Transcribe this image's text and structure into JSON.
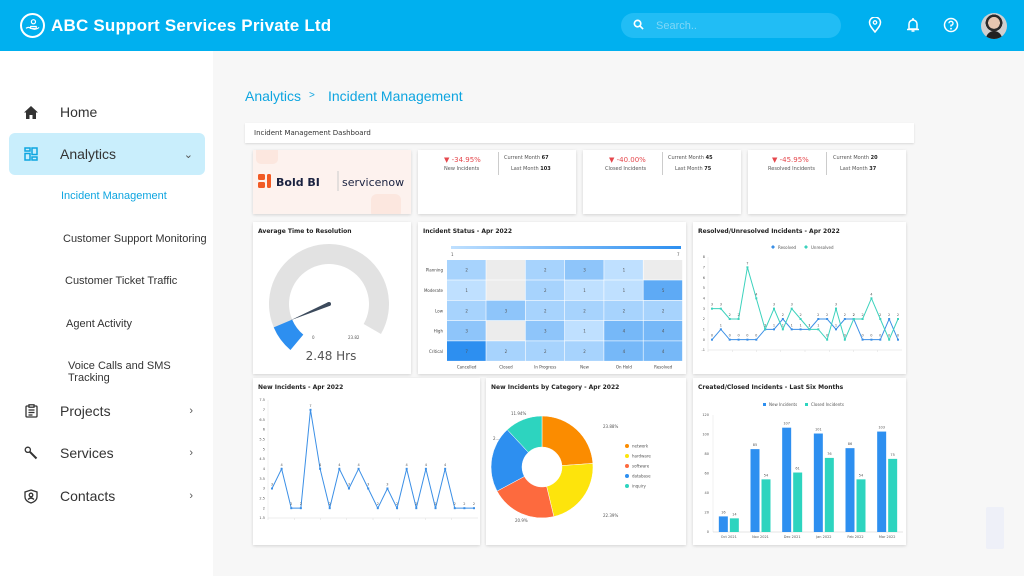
{
  "header": {
    "title": "ABC Support Services Private Ltd",
    "logo_icon": "hand-holding-person-icon",
    "search_placeholder": "Search..",
    "icons": [
      "location-pin-icon",
      "bell-icon",
      "help-circle-icon"
    ],
    "avatar": "user-avatar",
    "brand_color": "#00b0ef"
  },
  "sidebar": {
    "items": [
      {
        "label": "Home",
        "icon": "home-icon"
      },
      {
        "label": "Analytics",
        "icon": "dashboard-grid-icon",
        "active": true,
        "chevron": "chevron-down-icon"
      },
      {
        "label": "Projects",
        "icon": "clipboard-icon",
        "chevron": "chevron-right-icon"
      },
      {
        "label": "Services",
        "icon": "wrench-icon",
        "chevron": "chevron-right-icon"
      },
      {
        "label": "Contacts",
        "icon": "contact-shield-icon",
        "chevron": "chevron-right-icon"
      }
    ],
    "sub_items": [
      {
        "label": "Incident Management",
        "active": true
      },
      {
        "label": "Customer Support Monitoring"
      },
      {
        "label": "Customer Ticket Traffic"
      },
      {
        "label": "Agent Activity"
      },
      {
        "label": "Voice Calls and SMS Tracking"
      }
    ]
  },
  "breadcrumb": {
    "parent": "Analytics",
    "separator": ">",
    "current": "Incident Management"
  },
  "dashboard": {
    "title": "Incident Management Dashboard",
    "logos": {
      "boldbi": "Bold BI",
      "servicenow": "servicenow"
    },
    "kpis": [
      {
        "pct": "-34.95%",
        "label": "New Incidents",
        "current_label": "Current Month",
        "current": "67",
        "last_label": "Last Month",
        "last": "103"
      },
      {
        "pct": "-40.00%",
        "label": "Closed Incidents",
        "current_label": "Current Month",
        "current": "45",
        "last_label": "Last Month",
        "last": "75"
      },
      {
        "pct": "-45.95%",
        "label": "Resolved Incidents",
        "current_label": "Current Month",
        "current": "20",
        "last_label": "Last Month",
        "last": "37"
      }
    ],
    "gauge": {
      "title": "Average Time to Resolution",
      "value": 2.48,
      "value_label": "2.48 Hrs",
      "min": 0,
      "max": 23.82,
      "min_label": "0",
      "max_label": "23.82"
    },
    "titles": {
      "heatmap": "Incident Status - Apr 2022",
      "resolved": "Resolved/Unresolved Incidents - Apr 2022",
      "new_incidents": "New Incidents - Apr 2022",
      "category": "New Incidents by Category - Apr 2022",
      "created_closed": "Created/Closed Incidents - Last Six Months"
    }
  },
  "chart_data": [
    {
      "type": "heatmap",
      "title": "Incident Status - Apr 2022",
      "x": [
        "Cancelled",
        "Closed",
        "In Progress",
        "New",
        "On Hold",
        "Resolved"
      ],
      "y": [
        "Planning",
        "Moderate",
        "Low",
        "High",
        "Critical"
      ],
      "values": [
        [
          2,
          null,
          2,
          3,
          1,
          null
        ],
        [
          1,
          null,
          2,
          1,
          1,
          5
        ],
        [
          2,
          3,
          2,
          2,
          2,
          2
        ],
        [
          3,
          null,
          3,
          1,
          4,
          4
        ],
        [
          7,
          2,
          2,
          2,
          4,
          4
        ]
      ],
      "scale_min": 1,
      "scale_max": 7
    },
    {
      "type": "line",
      "title": "Resolved/Unresolved Incidents - Apr 2022",
      "legend": "top",
      "ylim": [
        -1,
        8
      ],
      "yticks": [
        -1,
        0,
        1,
        2,
        3,
        4,
        5,
        6,
        7,
        8
      ],
      "series": [
        {
          "name": "Resolved",
          "color": "#3b8fe6",
          "values": [
            0,
            1,
            0,
            0,
            0,
            0,
            1,
            1,
            2,
            1,
            1,
            1,
            2,
            2,
            1,
            2,
            2,
            0,
            0,
            0,
            2,
            0
          ]
        },
        {
          "name": "Unresolved",
          "color": "#3cd2bd",
          "values": [
            3,
            3,
            2,
            2,
            7,
            4,
            1,
            3,
            1,
            3,
            2,
            1,
            1,
            0,
            3,
            0,
            2,
            2,
            4,
            2,
            0,
            2
          ]
        }
      ]
    },
    {
      "type": "line",
      "title": "New Incidents - Apr 2022",
      "ylim": [
        1.5,
        7.5
      ],
      "yticks": [
        1.5,
        2,
        2.5,
        3,
        3.5,
        4,
        4.5,
        5,
        5.5,
        6,
        6.5,
        7,
        7.5
      ],
      "series": [
        {
          "name": "New Incidents",
          "color": "#3b8fe6",
          "values": [
            3,
            4,
            2,
            2,
            7,
            4,
            2,
            4,
            3,
            4,
            3,
            2,
            3,
            2,
            4,
            2,
            4,
            2,
            4,
            2,
            2,
            2
          ]
        }
      ]
    },
    {
      "type": "pie",
      "title": "New Incidents by Category - Apr 2022",
      "legend": "right",
      "slices": [
        {
          "label": "network",
          "value": 23.88,
          "color": "#fb8c00"
        },
        {
          "label": "hardware",
          "value": 22.39,
          "color": "#fde40c"
        },
        {
          "label": "software",
          "value": 20.9,
          "color": "#fd6a3e"
        },
        {
          "label": "database",
          "value": 20.9,
          "color": "#2d8ff0"
        },
        {
          "label": "inquiry",
          "value": 11.94,
          "color": "#2dd4bf"
        }
      ],
      "data_labels": [
        "23.88%",
        "22.39%",
        "20.9%",
        "2...",
        "11.94%"
      ]
    },
    {
      "type": "bar",
      "title": "Created/Closed Incidents - Last Six Months",
      "legend": "top",
      "categories": [
        "Oct 2021",
        "Nov 2021",
        "Dec 2021",
        "Jan 2022",
        "Feb 2022",
        "Mar 2022"
      ],
      "ylim": [
        0,
        120
      ],
      "yticks": [
        0,
        20,
        40,
        60,
        80,
        100,
        120
      ],
      "series": [
        {
          "name": "New Incidents",
          "color": "#2d8ff0",
          "values": [
            16,
            85,
            107,
            101,
            86,
            103
          ]
        },
        {
          "name": "Closed Incidents",
          "color": "#2dd4bf",
          "values": [
            14,
            54,
            61,
            76,
            54,
            75
          ]
        }
      ]
    }
  ]
}
